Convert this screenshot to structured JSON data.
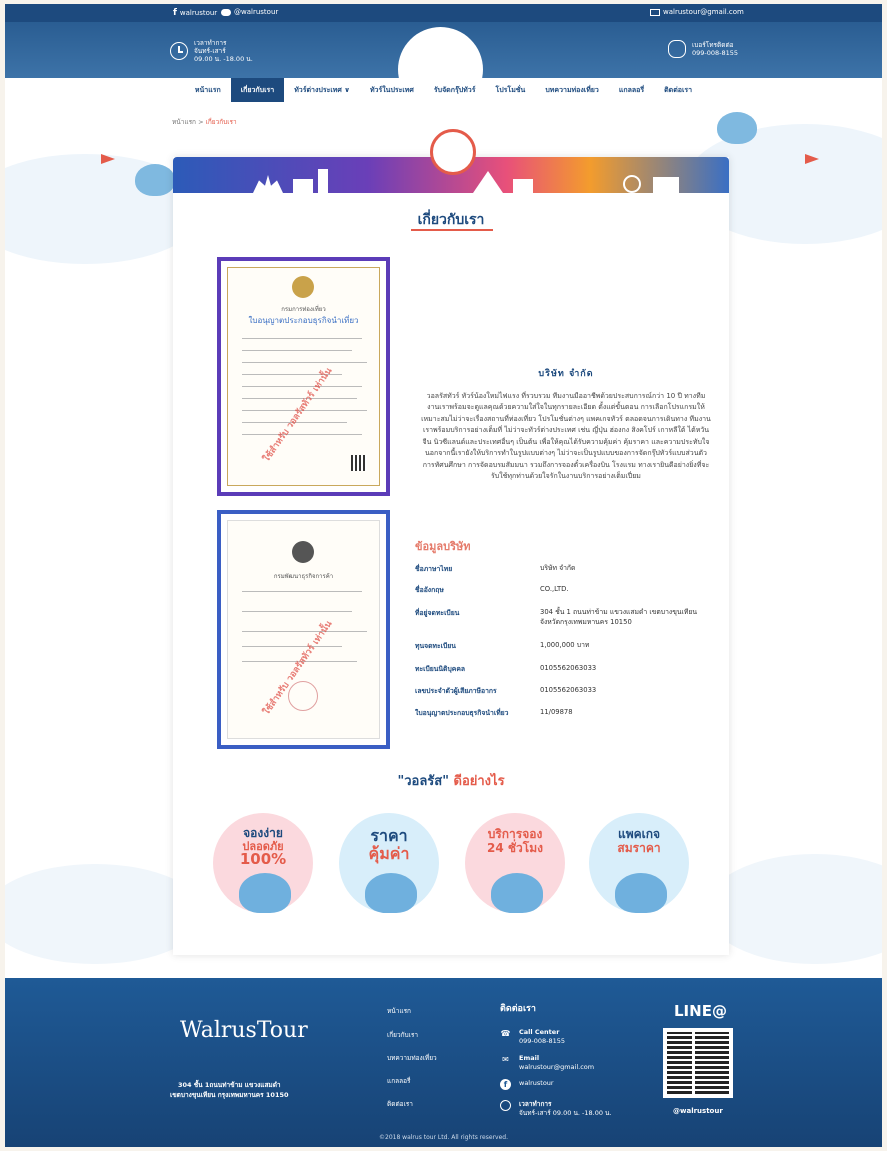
{
  "topbar": {
    "facebook": "walrustour",
    "line": "@walrustour",
    "email": "walrustour@gmail.com"
  },
  "header": {
    "hours_label": "เวลาทำการ",
    "hours_days": "จันทร์-เสาร์",
    "hours_time": "09.00 น. -18.00 น.",
    "phone_label": "เบอร์โทรติดต่อ",
    "phone": "099-008-8155"
  },
  "nav": {
    "items": [
      "หน้าแรก",
      "เกี่ยวกับเรา",
      "ทัวร์ต่างประเทศ",
      "ทัวร์ในประเทศ",
      "รับจัดกรุ๊ปทัวร์",
      "โปรโมชั่น",
      "บทความท่องเที่ยว",
      "แกลลอรี่",
      "ติดต่อเรา"
    ]
  },
  "breadcrumb": {
    "home": "หน้าแรก",
    "sep": ">",
    "current": "เกี่ยวกับเรา"
  },
  "page": {
    "title": "เกี่ยวกับเรา",
    "company_heading": "บริษัท             จำกัด",
    "about_text": "วอลรัสทัวร์ ทัวร์น้องใหม่ไฟแรง ที่รวบรวม ทีมงานมืออาชีพด้วยประสบการณ์กว่า 10 ปี ทางทีมงานเราพร้อมจะดูแลคุณด้วยความใส่ใจในทุกรายละเอียด ตั้งแต่ขั้นตอน การเลือกโปรแกรมให้เหมาะสมไม่ว่าจะเรื่องสถานที่ท่องเที่ยว โปรโมชั่นต่างๆ แพคเกจทัวร์ ตลอดจนการเดินทาง ทีมงานเราพร้อมบริการอย่างเต็มที่ ไม่ว่าจะทัวร์ต่างประเทศ เช่น ญี่ปุ่น ฮ่องกง สิงคโปร์ เกาหลีใต้ ไต้หวัน จีน นิวซีแลนด์และประเทศอื่นๆ เป็นต้น เพื่อให้คุณได้รับความคุ้มค่า คุ้มราคา และความประทับใจนอกจากนี้เรายังให้บริการทำในรูปแบบต่างๆ ไม่ว่าจะเป็นรูปแบบของการจัดกรุ๊ปทัวร์แบบส่วนตัว การทัศนศึกษา การจัดอบรมสัมมนา รวมถึงการจองตั๋วเครื่องบิน โรงแรม ทางเรายินดีอย่างยิ่งที่จะรับใช้ทุกท่านด้วยใจรักในงานบริการอย่างเต็มเปี่ยม",
    "cert1_title": "กรมการท่องเที่ยว",
    "cert1_sub": "ใบอนุญาตประกอบธุรกิจนำเที่ยว",
    "cert2_title": "กรมพัฒนาธุรกิจการค้า",
    "cert_stamp": "ใช้สำหรับ วอลรัสทัวร์ เท่านั้น",
    "company_info_title": "ข้อมูลบริษัท",
    "company_rows": [
      {
        "k": "ชื่อภาษาไทย",
        "v": "บริษัท             จำกัด"
      },
      {
        "k": "ชื่ออังกฤษ",
        "v": "                          CO.,LTD."
      },
      {
        "k": "ที่อยู่จดทะเบียน",
        "v": "304 ชั้น 1 ถนนท่าข้าม แขวงแสมดำ เขตบางขุนเทียน จังหวัดกรุงเทพมหานคร 10150"
      },
      {
        "k": "ทุนจดทะเบียน",
        "v": "1,000,000 บาท"
      },
      {
        "k": "ทะเบียนนิติบุคคล",
        "v": "0105562063033"
      },
      {
        "k": "เลขประจำตัวผู้เสียภาษีอากร",
        "v": "0105562063033"
      },
      {
        "k": "ใบอนุญาตประกอบธุรกิจนำเที่ยว",
        "v": "11/09878"
      }
    ],
    "why_a": "\"วอลรัส\"",
    "why_b": "ดีอย่างไร",
    "features": [
      {
        "line1": "จองง่าย",
        "line2": "ปลอดภัย",
        "line3": "100%"
      },
      {
        "line1": "ราคา",
        "line2": "คุ้มค่า",
        "line3": ""
      },
      {
        "line1": "บริการจอง",
        "line2": "24 ชั่วโมง",
        "line3": ""
      },
      {
        "line1": "แพคเกจ",
        "line2": "สมราคา",
        "line3": ""
      }
    ]
  },
  "footer": {
    "logo": "WalrusTour",
    "address1": "304 ชั้น 1ถนนท่าข้าม แขวงแสมดำ",
    "address2": "เขตบางขุนเทียน กรุงเทพมหานคร 10150",
    "links": [
      "หน้าแรก",
      "เกี่ยวกับเรา",
      "บทความท่องเที่ยว",
      "แกลลอรี่",
      "ติดต่อเรา"
    ],
    "contact_heading": "ติดต่อเรา",
    "call_label": "Call Center",
    "call": "099-008-8155",
    "email_label": "Email",
    "email": "walrustour@gmail.com",
    "facebook": "walrustour",
    "hours_label": "เวลาทำการ",
    "hours": "จันทร์-เสาร์ 09.00 น. -18.00 น.",
    "line_heading": "LINE@",
    "line_id": "@walrustour",
    "copyright": "©2018 walrus tour Ltd. All rights reserved."
  },
  "colors": {
    "brand_blue": "#1d4a7e",
    "accent_red": "#e45b4a",
    "pink": "#fbd9de",
    "light_blue": "#d8eefa"
  }
}
